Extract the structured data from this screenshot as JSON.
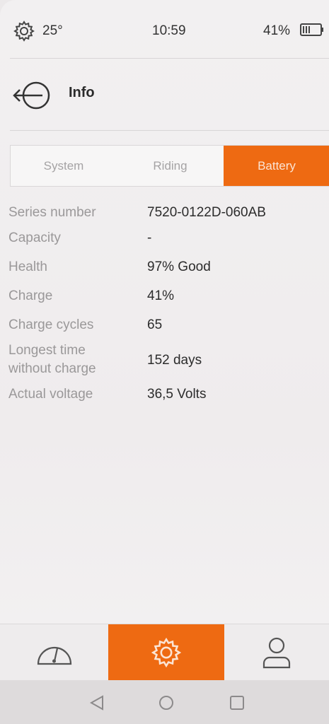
{
  "status_bar": {
    "temperature": "25°",
    "time": "10:59",
    "battery_percent": "41%",
    "icons": [
      "settings-gear-icon",
      "battery-icon"
    ]
  },
  "header": {
    "title": "Info",
    "back_icon": "back-arrow-icon"
  },
  "tabs": [
    {
      "label": "System",
      "active": false
    },
    {
      "label": "Riding",
      "active": false
    },
    {
      "label": "Battery",
      "active": true
    }
  ],
  "battery_info": [
    {
      "label": "Series number",
      "value": "7520-0122D-060AB"
    },
    {
      "label": "Capacity",
      "value": "-"
    },
    {
      "label": "Health",
      "value": "97% Good"
    },
    {
      "label": "Charge",
      "value": "41%"
    },
    {
      "label": "Charge cycles",
      "value": "65"
    },
    {
      "label": "Longest time\nwithout charge",
      "value": "152 days"
    },
    {
      "label": "Actual voltage",
      "value": "36,5 Volts"
    }
  ],
  "bottom_nav": [
    {
      "icon": "speedometer-icon",
      "active": false
    },
    {
      "icon": "settings-gear-icon",
      "active": true
    },
    {
      "icon": "user-profile-icon",
      "active": false
    }
  ],
  "system_nav": [
    "back-triangle-icon",
    "home-circle-icon",
    "recents-square-icon"
  ],
  "colors": {
    "accent": "#ee6a12",
    "label_text": "#9a9899",
    "value_text": "#2c2c2c",
    "background": "#f0eeef"
  }
}
